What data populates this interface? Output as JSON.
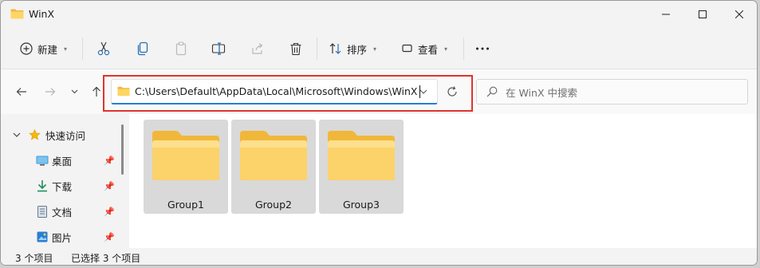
{
  "window": {
    "title": "WinX"
  },
  "toolbar": {
    "new_label": "新建",
    "sort_label": "排序",
    "view_label": "查看",
    "more_label": "···"
  },
  "nav": {
    "address_path": "C:\\Users\\Default\\AppData\\Local\\Microsoft\\Windows\\WinX",
    "search_placeholder": "在 WinX 中搜索"
  },
  "sidebar": {
    "quick_access_label": "快速访问",
    "items": [
      {
        "label": "桌面",
        "icon": "desktop-icon"
      },
      {
        "label": "下载",
        "icon": "download-icon"
      },
      {
        "label": "文档",
        "icon": "document-icon"
      },
      {
        "label": "图片",
        "icon": "pictures-icon"
      }
    ]
  },
  "content": {
    "folders": [
      {
        "name": "Group1"
      },
      {
        "name": "Group2"
      },
      {
        "name": "Group3"
      }
    ]
  },
  "status": {
    "item_count": "3 个项目",
    "selected_count": "已选择 3 个项目"
  },
  "colors": {
    "folder_yellow": "#f8c94a",
    "highlight_red": "#e0332d",
    "accent_blue": "#2a7bd1",
    "selection_gray": "#d9d9d9"
  }
}
